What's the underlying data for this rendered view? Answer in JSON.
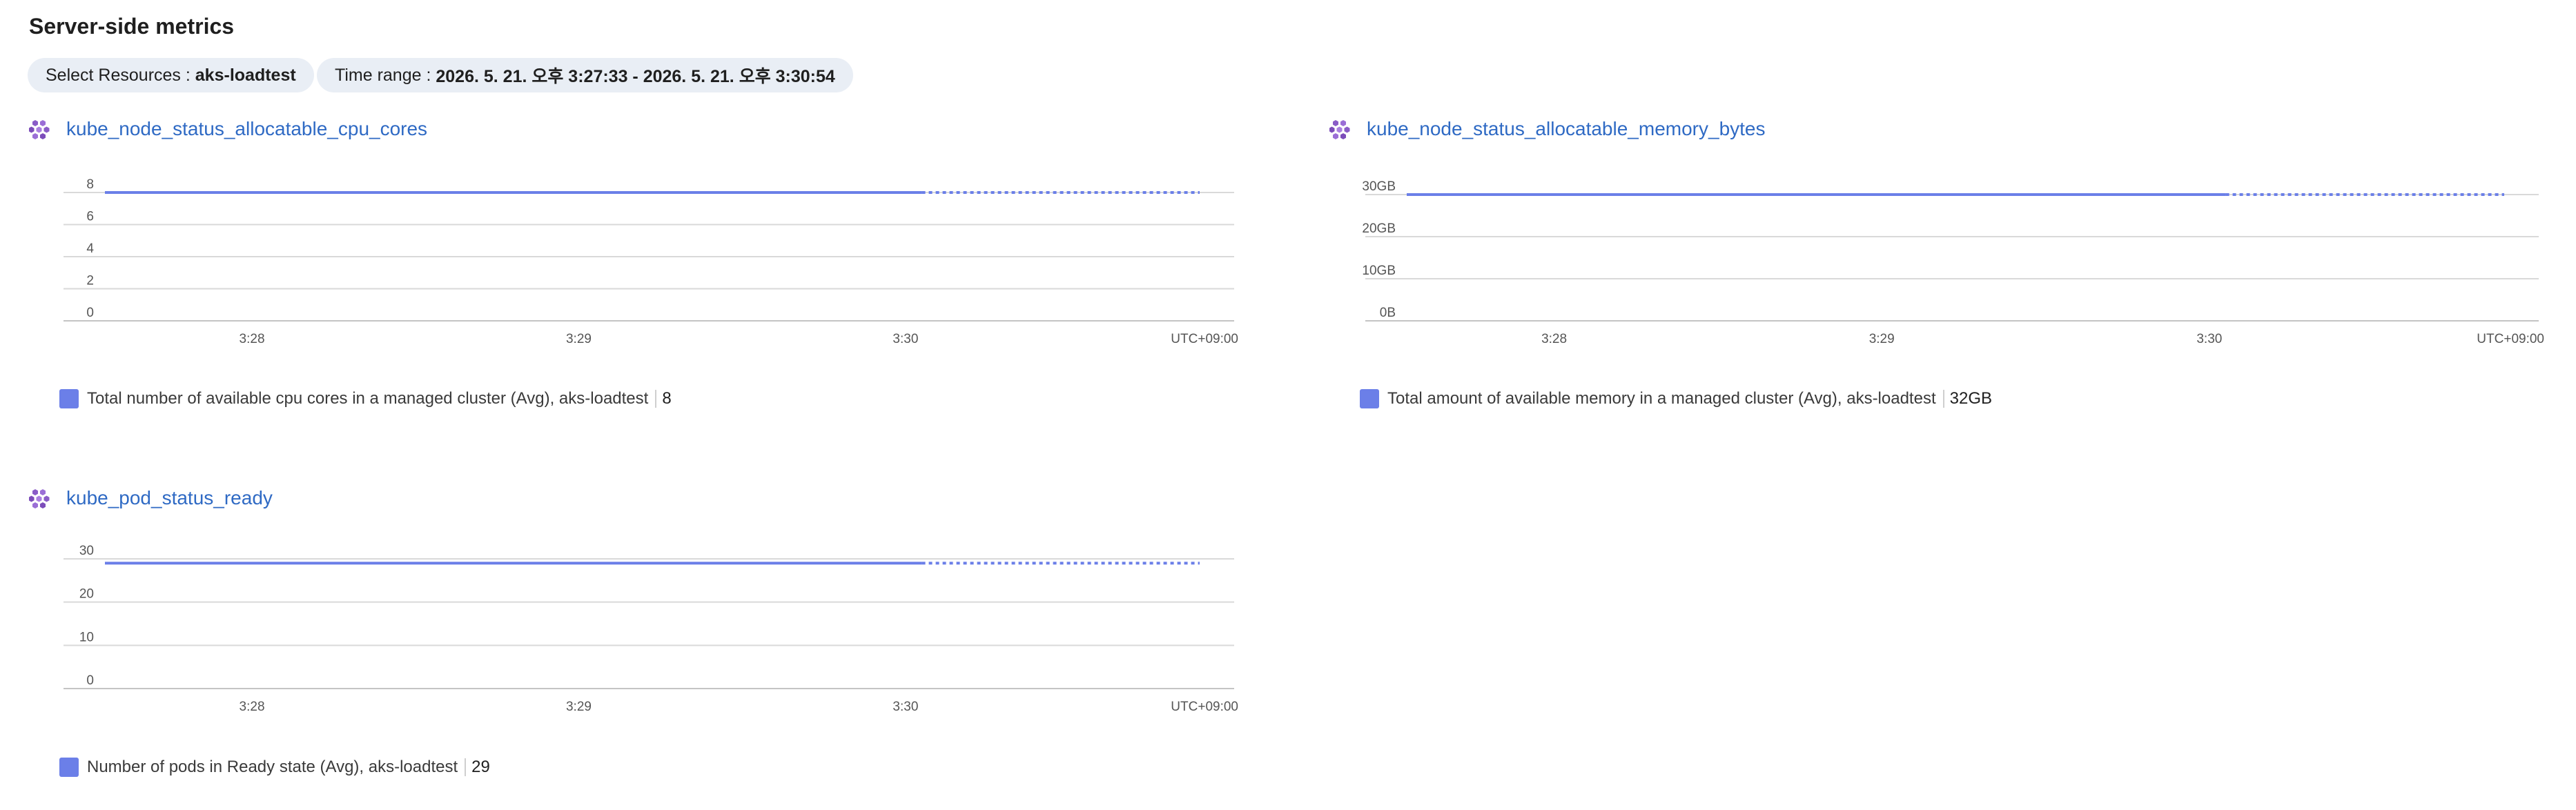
{
  "page": {
    "title": "Server-side metrics"
  },
  "filters": {
    "resources_label": "Select Resources : ",
    "resources_value": "aks-loadtest",
    "time_label": "Time range : ",
    "time_value": "2026. 5. 21. 오후 3:27:33 - 2026. 5. 21. 오후 3:30:54"
  },
  "colors": {
    "series": "#6b7fe8",
    "link": "#2f6ac4",
    "grid": "#d9d9d9",
    "icon": "#8a5cc7"
  },
  "charts": [
    {
      "title": "kube_node_status_allocatable_cpu_cores",
      "icon": "kubernetes-cluster-icon",
      "legend_label": "Total number of available cpu cores in a managed cluster (Avg), aks-loadtest",
      "legend_value": "8"
    },
    {
      "title": "kube_node_status_allocatable_memory_bytes",
      "icon": "kubernetes-cluster-icon",
      "legend_label": "Total amount of available memory in a managed cluster (Avg), aks-loadtest",
      "legend_value": "32GB"
    },
    {
      "title": "kube_pod_status_ready",
      "icon": "kubernetes-cluster-icon",
      "legend_label": "Number of pods in Ready state (Avg), aks-loadtest",
      "legend_value": "29"
    }
  ],
  "chart_data": [
    {
      "type": "line",
      "title": "kube_node_status_allocatable_cpu_cores",
      "x_ticks": [
        "3:28",
        "3:29",
        "3:30"
      ],
      "timezone_label": "UTC+09:00",
      "x_range": [
        "3:27:33",
        "3:30:54"
      ],
      "y_ticks": [
        "0",
        "2",
        "4",
        "6",
        "8"
      ],
      "ylim": [
        0,
        8
      ],
      "grid": true,
      "legend_position": "bottom-left",
      "series": [
        {
          "name": "Total number of available cpu cores in a managed cluster (Avg), aks-loadtest",
          "solid": {
            "x": [
              "3:27:33",
              "3:30:03"
            ],
            "y": [
              8,
              8
            ]
          },
          "dotted": {
            "x": [
              "3:30:03",
              "3:30:54"
            ],
            "y": [
              8,
              8
            ]
          }
        }
      ]
    },
    {
      "type": "line",
      "title": "kube_node_status_allocatable_memory_bytes",
      "x_ticks": [
        "3:28",
        "3:29",
        "3:30"
      ],
      "timezone_label": "UTC+09:00",
      "x_range": [
        "3:27:33",
        "3:30:54"
      ],
      "y_ticks": [
        "0B",
        "10GB",
        "20GB",
        "30GB"
      ],
      "ylim": [
        0,
        30
      ],
      "y_unit": "GB",
      "grid": true,
      "legend_position": "bottom-left",
      "series": [
        {
          "name": "Total amount of available memory in a managed cluster (Avg), aks-loadtest",
          "solid": {
            "x": [
              "3:27:33",
              "3:30:03"
            ],
            "y": [
              30,
              30
            ]
          },
          "dotted": {
            "x": [
              "3:30:03",
              "3:30:54"
            ],
            "y": [
              30,
              30
            ]
          }
        }
      ]
    },
    {
      "type": "line",
      "title": "kube_pod_status_ready",
      "x_ticks": [
        "3:28",
        "3:29",
        "3:30"
      ],
      "timezone_label": "UTC+09:00",
      "x_range": [
        "3:27:33",
        "3:30:54"
      ],
      "y_ticks": [
        "0",
        "10",
        "20",
        "30"
      ],
      "ylim": [
        0,
        30
      ],
      "grid": true,
      "legend_position": "bottom-left",
      "series": [
        {
          "name": "Number of pods in Ready state (Avg), aks-loadtest",
          "solid": {
            "x": [
              "3:27:33",
              "3:30:03"
            ],
            "y": [
              29,
              29
            ]
          },
          "dotted": {
            "x": [
              "3:30:03",
              "3:30:54"
            ],
            "y": [
              29,
              29
            ]
          }
        }
      ]
    }
  ]
}
